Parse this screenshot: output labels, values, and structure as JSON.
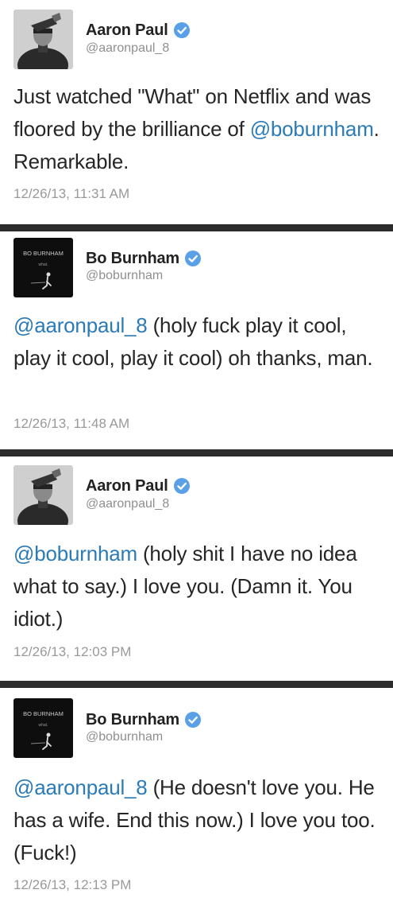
{
  "tweets": [
    {
      "display_name": "Aaron Paul",
      "handle": "@aaronpaul_8",
      "avatar_icon": "aaron-paul-avatar-icon",
      "mention": "",
      "body": "Just watched \"What\" on Netflix and was floored by the brilliance of ",
      "tail_mention": "@boburnham",
      "tail": ". Remarkable.",
      "timestamp": "12/26/13, 11:31 AM"
    },
    {
      "display_name": "Bo Burnham",
      "handle": "@boburnham",
      "avatar_icon": "bo-burnham-album-avatar-icon",
      "avatar_label": "BO BURNHAM",
      "avatar_sublabel": "what.",
      "mention": "@aaronpaul_8",
      "body": " (holy fuck play it cool, play it cool, play it cool) oh thanks, man.",
      "tail_mention": "",
      "tail": "",
      "timestamp": "12/26/13, 11:48 AM"
    },
    {
      "display_name": "Aaron Paul",
      "handle": "@aaronpaul_8",
      "avatar_icon": "aaron-paul-avatar-icon",
      "mention": "@boburnham",
      "body": " (holy shit I have no idea what to say.) I love you. (Damn it. You idiot.)",
      "tail_mention": "",
      "tail": "",
      "timestamp": "12/26/13, 12:03 PM"
    },
    {
      "display_name": "Bo Burnham",
      "handle": "@boburnham",
      "avatar_icon": "bo-burnham-album-avatar-icon",
      "avatar_label": "BO BURNHAM",
      "avatar_sublabel": "what.",
      "mention": "@aaronpaul_8",
      "body": " (He doesn't love you. He has a wife. End this now.) I love you too. (Fuck!)",
      "tail_mention": "",
      "tail": "",
      "timestamp": "12/26/13, 12:13 PM"
    }
  ],
  "colors": {
    "mention": "#2b7bb9",
    "verified": "#5aa0e6",
    "separator": "#2c2c2c",
    "timestamp": "#999999"
  }
}
